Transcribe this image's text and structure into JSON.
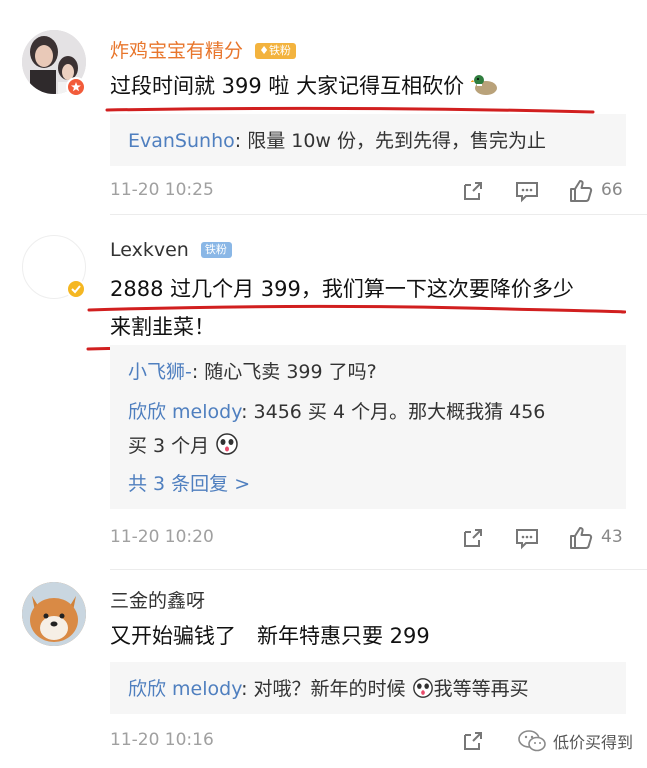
{
  "comments": [
    {
      "user": "炸鸡宝宝有精分",
      "badge": "铁粉",
      "text": "过段时间就 399 啦 大家记得互相砍价",
      "reply_user": "EvanSunho",
      "reply_text": ": 限量 10w 份，先到先得，售完为止",
      "time": "11-20 10:25",
      "likes": "66"
    },
    {
      "user": "Lexkven",
      "badge": "铁粉",
      "text_line1": "2888 过几个月 399，我们算一下这次要降价多少",
      "text_line2": "来割韭菜！",
      "replies": [
        {
          "user": "小飞狮-",
          "text": ": 随心飞卖 399 了吗?"
        },
        {
          "user": "欣欣 melody",
          "text": ": 3456 买 4 个月。那大概我猜 456",
          "text2": "买 3 个月"
        }
      ],
      "more": "共 3 条回复 >",
      "time": "11-20 10:20",
      "likes": "43"
    },
    {
      "user": "三金的鑫呀",
      "text": "又开始骗钱了　新年特惠只要 299",
      "reply_user": "欣欣 melody",
      "reply_text": ": 对哦？新年的时候",
      "reply_text_after": "我等等再买",
      "time": "11-20 10:16"
    }
  ],
  "watermark": "低价买得到",
  "colors": {
    "accent_orange": "#e8762c",
    "reply_blue": "#4f7fbf",
    "underline_red": "#d11f1f"
  }
}
